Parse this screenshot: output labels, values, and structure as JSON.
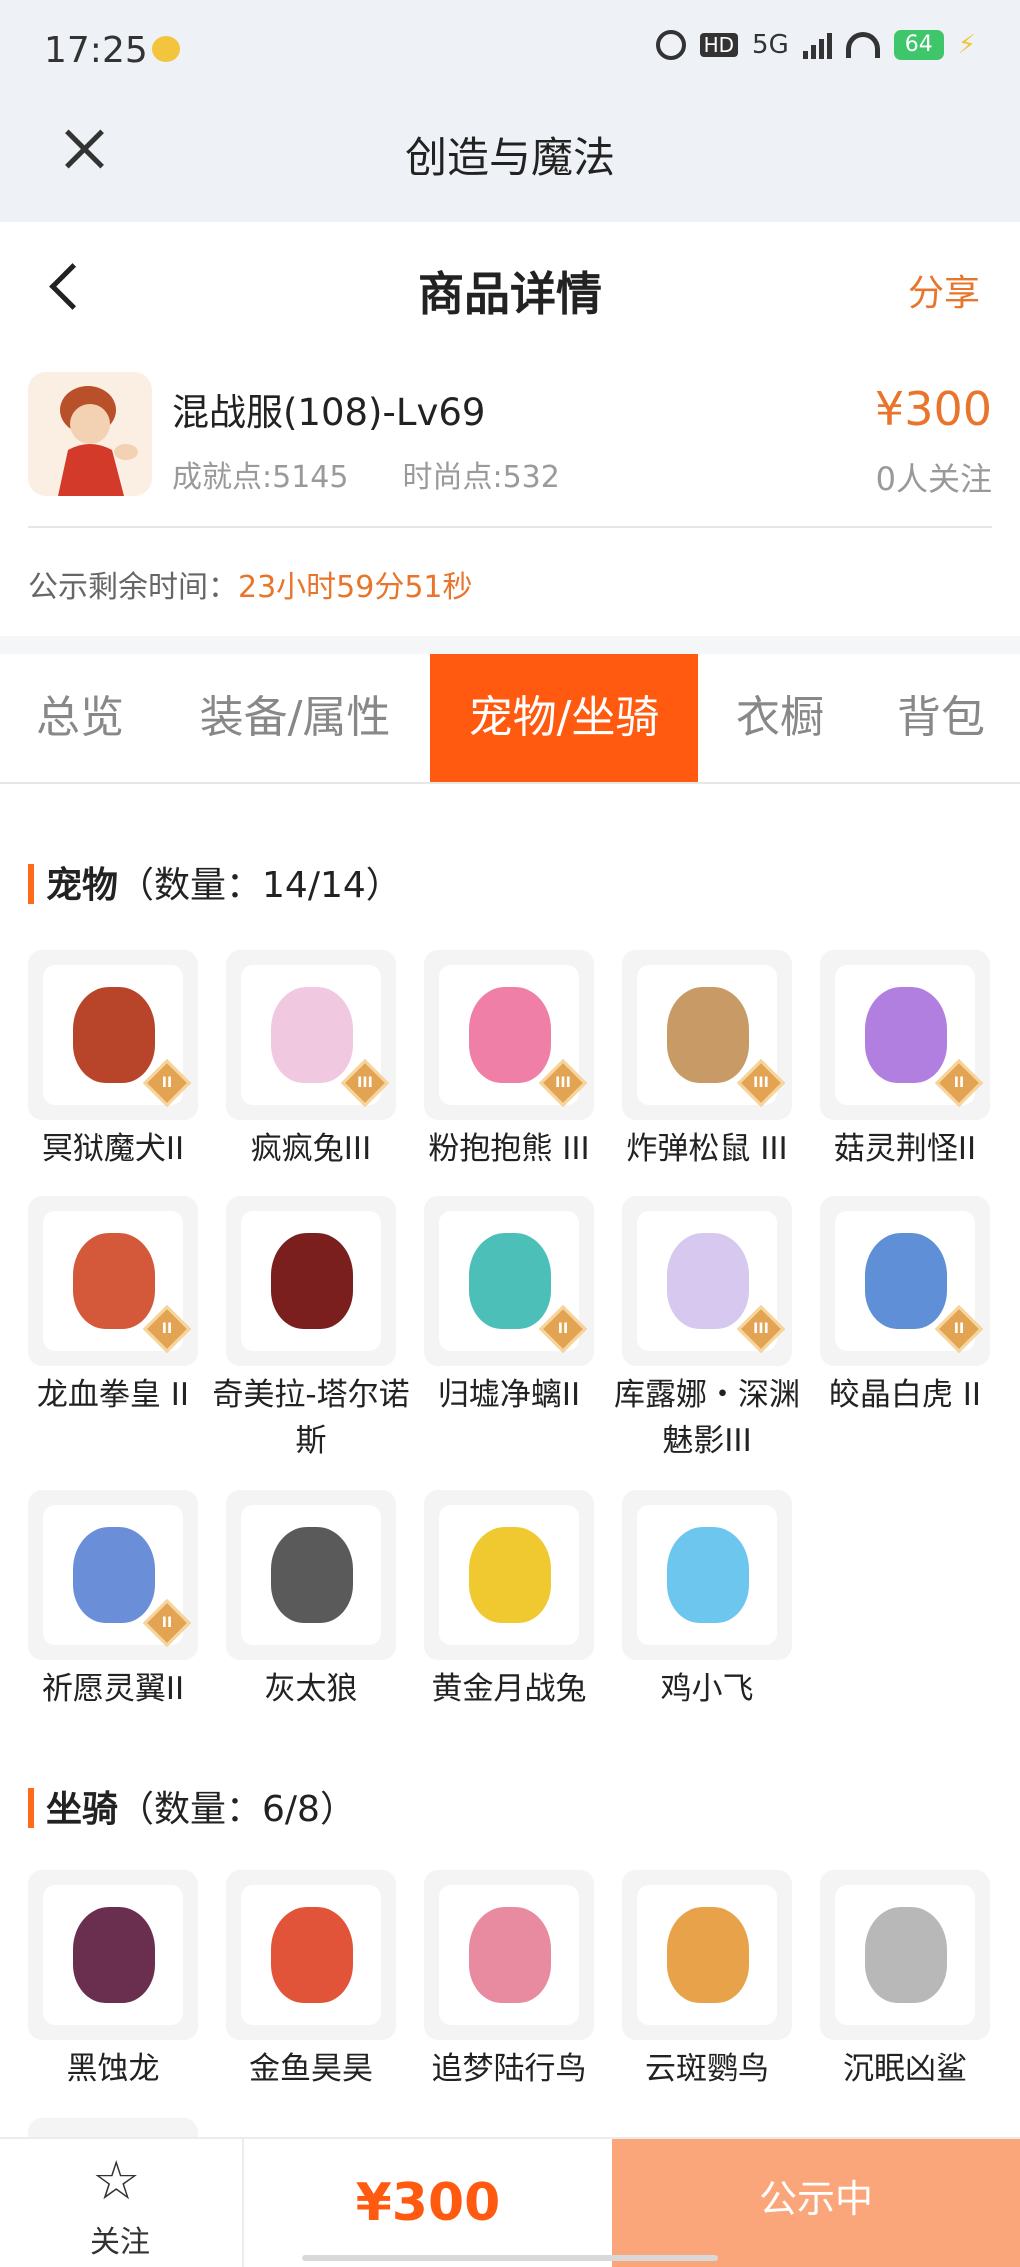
{
  "status_bar": {
    "time": "17:25",
    "network": "5G",
    "battery": "64",
    "hd": "HD"
  },
  "app_header": {
    "title": "创造与魔法"
  },
  "page_nav": {
    "title": "商品详情",
    "share": "分享"
  },
  "product": {
    "name": "混战服(108)-Lv69",
    "achievement": "成就点:5145",
    "fashion": "时尚点:532",
    "price": "¥300",
    "followers": "0人关注"
  },
  "countdown": {
    "label": "公示剩余时间：",
    "value": "23小时59分51秒"
  },
  "tabs": [
    {
      "label": "总览",
      "active": false
    },
    {
      "label": "装备/属性",
      "active": false
    },
    {
      "label": "宠物/坐骑",
      "active": true
    },
    {
      "label": "衣橱",
      "active": false
    },
    {
      "label": "背包",
      "active": false
    }
  ],
  "pets": {
    "title": "宠物",
    "count": "（数量：14/14）",
    "items": [
      {
        "name": "冥狱魔犬II",
        "tier": "II",
        "color": "#b8452a"
      },
      {
        "name": "疯疯兔III",
        "tier": "III",
        "color": "#f0c8e0"
      },
      {
        "name": "粉抱抱熊 III",
        "tier": "III",
        "color": "#ef7fa6"
      },
      {
        "name": "炸弹松鼠 III",
        "tier": "III",
        "color": "#c79a66"
      },
      {
        "name": "菇灵荆怪II",
        "tier": "II",
        "color": "#b07fe0"
      },
      {
        "name": "龙血拳皇 II",
        "tier": "II",
        "color": "#d4593a"
      },
      {
        "name": "奇美拉-塔尔诺斯",
        "tier": "",
        "color": "#7a1e1e"
      },
      {
        "name": "归墟净螭II",
        "tier": "II",
        "color": "#4cc0b8"
      },
      {
        "name": "库露娜・深渊魅影III",
        "tier": "III",
        "color": "#d6c8ee"
      },
      {
        "name": "皎晶白虎 II",
        "tier": "II",
        "color": "#5f8fd6"
      },
      {
        "name": "祈愿灵翼II",
        "tier": "II",
        "color": "#6a8ed8"
      },
      {
        "name": "灰太狼",
        "tier": "",
        "color": "#5a5a5a"
      },
      {
        "name": "黄金月战兔",
        "tier": "",
        "color": "#f0c830"
      },
      {
        "name": "鸡小飞",
        "tier": "",
        "color": "#6cc6ee"
      }
    ]
  },
  "mounts": {
    "title": "坐骑",
    "count": "（数量：6/8）",
    "items": [
      {
        "name": "黑蚀龙",
        "tier": "",
        "color": "#6a2e4e"
      },
      {
        "name": "金鱼昊昊",
        "tier": "",
        "color": "#e2543a"
      },
      {
        "name": "追梦陆行鸟",
        "tier": "",
        "color": "#e88aa0"
      },
      {
        "name": "云斑鹦鸟",
        "tier": "",
        "color": "#e8a24a"
      },
      {
        "name": "沉眠凶鲨",
        "tier": "",
        "color": "#b8b8b8"
      }
    ]
  },
  "bottom_bar": {
    "follow": "关注",
    "price": "¥300",
    "status": "公示中"
  }
}
